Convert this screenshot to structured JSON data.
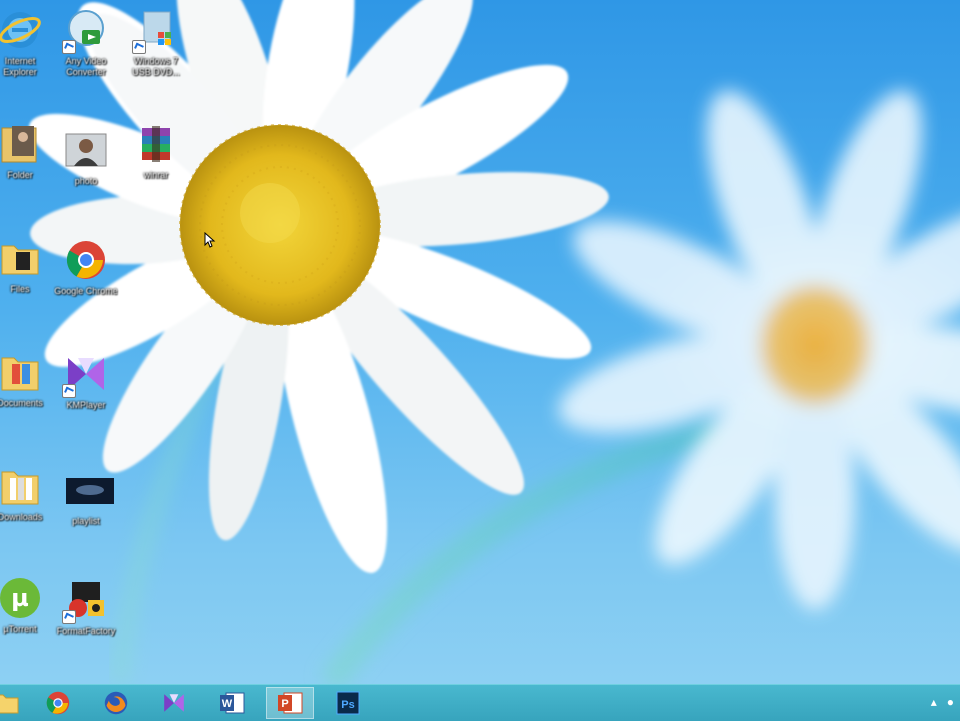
{
  "desktop": {
    "icons": [
      {
        "name": "internet-explorer-icon",
        "label": "Internet Explorer"
      },
      {
        "name": "easy-video-converter-icon",
        "label": "Any Video Converter"
      },
      {
        "name": "windows-7-usb-dvd-icon",
        "label": "Windows 7 USB DVD..."
      },
      {
        "name": "user-folder-icon",
        "label": "Folder"
      },
      {
        "name": "user-photo-icon",
        "label": "photo"
      },
      {
        "name": "winrar-icon",
        "label": "winrar"
      },
      {
        "name": "files-folder-icon",
        "label": "Files"
      },
      {
        "name": "google-chrome-icon",
        "label": "Google Chrome"
      },
      {
        "name": "documents-folder-icon",
        "label": "Documents"
      },
      {
        "name": "kmplayer-icon",
        "label": "KMPlayer"
      },
      {
        "name": "downloads-folder-icon",
        "label": "Downloads"
      },
      {
        "name": "movie-file-icon",
        "label": "playlist"
      },
      {
        "name": "utorrent-icon",
        "label": "µTorrent"
      },
      {
        "name": "format-factory-icon",
        "label": "FormatFactory"
      }
    ]
  },
  "taskbar": {
    "items": [
      {
        "name": "file-explorer-taskbar-icon"
      },
      {
        "name": "chrome-taskbar-icon"
      },
      {
        "name": "firefox-taskbar-icon"
      },
      {
        "name": "kmplayer-taskbar-icon"
      },
      {
        "name": "word-taskbar-icon",
        "letter": "W"
      },
      {
        "name": "powerpoint-taskbar-icon",
        "letter": "P",
        "active": true
      },
      {
        "name": "photoshop-taskbar-icon",
        "letter": "Ps"
      }
    ],
    "tray": {
      "arrow": "▴",
      "dot": "●"
    }
  },
  "colors": {
    "accent": "#37a4bd",
    "desktop": "#3fa6ec"
  }
}
